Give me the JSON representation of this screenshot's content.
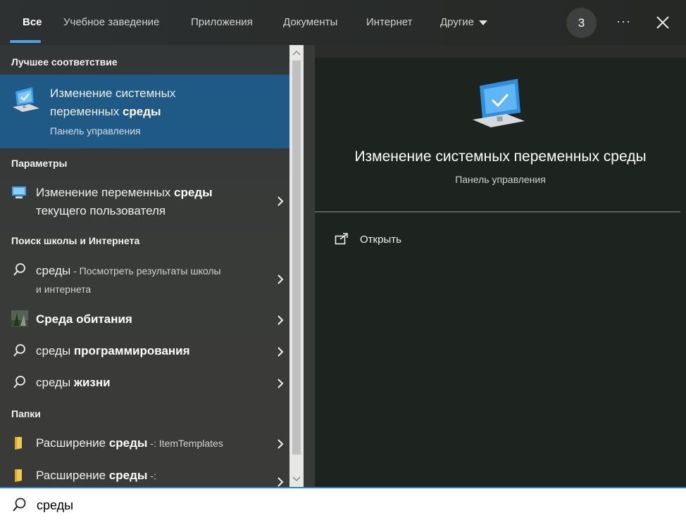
{
  "tabs": [
    {
      "label": "Все"
    },
    {
      "label": "Учебное заведение"
    },
    {
      "label": "Приложения"
    },
    {
      "label": "Документы"
    },
    {
      "label": "Интернет"
    },
    {
      "label": "Другие"
    }
  ],
  "header": {
    "badge": "3",
    "more_label": "···"
  },
  "sections": {
    "best": "Лучшее соответствие",
    "settings": "Параметры",
    "web": "Поиск школы и Интернета",
    "folders": "Папки"
  },
  "best_match": {
    "title_part1": "Изменение системных",
    "title_part2": "переменных ",
    "title_bold": "среды",
    "subtitle": "Панель управления"
  },
  "settings_item": {
    "line1_part1": "Изменение переменных ",
    "line1_bold": "среды",
    "line2": "текущего пользователя"
  },
  "web_items": [
    {
      "prefix": "среды",
      "suffix": " - Посмотреть результаты школы",
      "line2": "и интернета"
    },
    {
      "bold": "Среда обитания"
    },
    {
      "normal": "среды ",
      "bold": "программирования"
    },
    {
      "normal": "среды ",
      "bold": "жизни"
    }
  ],
  "folder_items": [
    {
      "normal": "Расширение ",
      "bold": "среды",
      "suffix": " -: ItemTemplates"
    },
    {
      "normal": "Расширение ",
      "bold": "среды",
      "suffix": " -:"
    }
  ],
  "preview": {
    "title": "Изменение системных переменных среды",
    "subtitle": "Панель управления",
    "open_label": "Открыть"
  },
  "search": {
    "value": "среды"
  },
  "colors": {
    "accent": "#4aa3e8",
    "selected": "#1f5a86",
    "search_border": "#2f7fd0"
  }
}
